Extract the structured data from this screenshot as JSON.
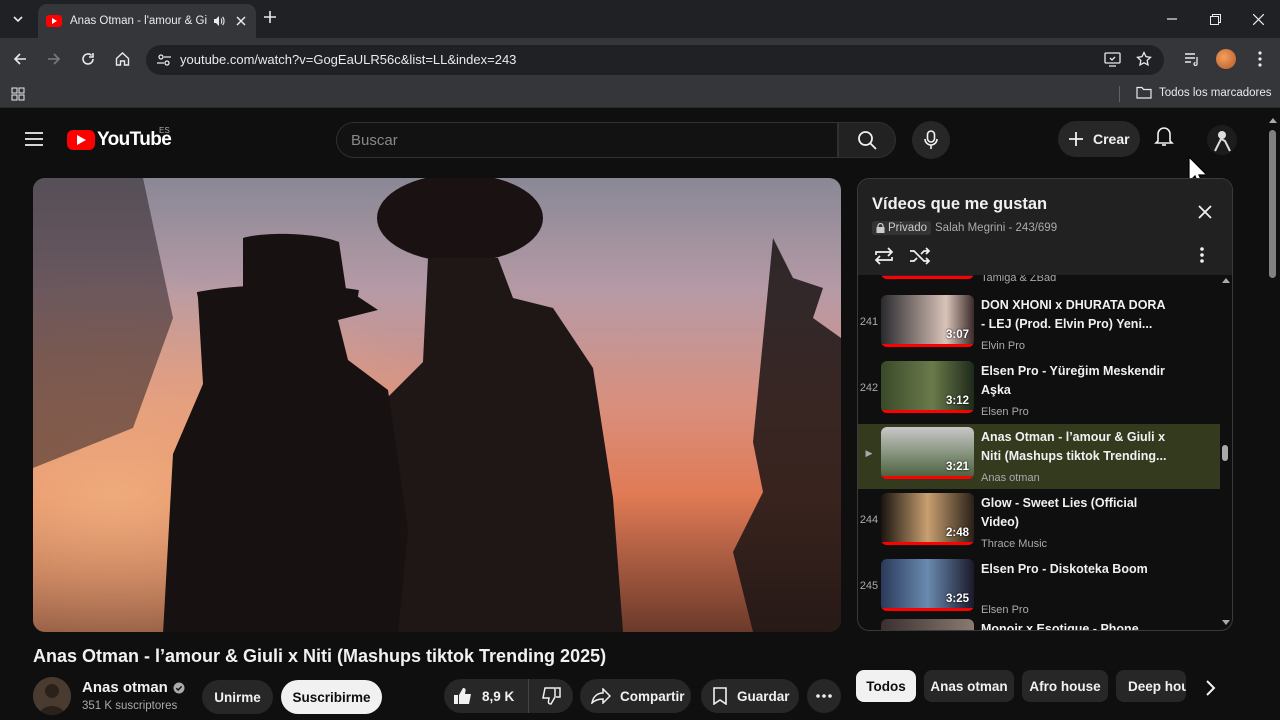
{
  "browser": {
    "tab": {
      "title": "Anas Otman - l'amour & Gi"
    },
    "url": "youtube.com/watch?v=GogEaULR56c&list=LL&index=243",
    "bookmarks_label": "Todos los marcadores"
  },
  "header": {
    "logo_text": "YouTube",
    "country_code": "ES",
    "search_placeholder": "Buscar",
    "create_label": "Crear"
  },
  "video": {
    "title": "Anas Otman - l’amour & Giuli x Niti (Mashups tiktok Trending 2025)",
    "channel": "Anas otman",
    "subscribers": "351 K suscriptores",
    "join_label": "Unirme",
    "subscribe_label": "Suscribirme",
    "likes": "8,9 K",
    "share_label": "Compartir",
    "save_label": "Guardar"
  },
  "playlist": {
    "title": "Vídeos que me gustan",
    "privacy": "Privado",
    "owner_position": "Salah Megrini - 243/699",
    "partial_top_channel": "Tamiga & ZBad",
    "items": [
      {
        "index": "241",
        "title": "DON XHONI x DHURATA DORA - LEJ (Prod. Elvin Pro) Yeni...",
        "channel": "Elvin Pro",
        "duration": "3:07",
        "active": false
      },
      {
        "index": "242",
        "title": "Elsen Pro - Yüreğim Meskendir Aşka",
        "channel": "Elsen Pro",
        "duration": "3:12",
        "active": false
      },
      {
        "index": "▶",
        "title": "Anas Otman - l’amour & Giuli x Niti (Mashups tiktok Trending...",
        "channel": "Anas otman",
        "duration": "3:21",
        "active": true
      },
      {
        "index": "244",
        "title": "Glow - Sweet Lies (Official Video)",
        "channel": "Thrace Music",
        "duration": "2:48",
        "active": false
      },
      {
        "index": "245",
        "title": "Elsen Pro - Diskoteka Boom",
        "channel": "Elsen Pro",
        "duration": "3:25",
        "active": false
      },
      {
        "index": "",
        "title": "Monoir x Esotique - Phone",
        "channel": "",
        "duration": "",
        "active": false
      }
    ]
  },
  "chips": [
    "Todos",
    "Anas otman",
    "Afro house",
    "Deep house"
  ],
  "colors": {
    "accent": "#ff0000",
    "active_row": "#343a1e"
  }
}
